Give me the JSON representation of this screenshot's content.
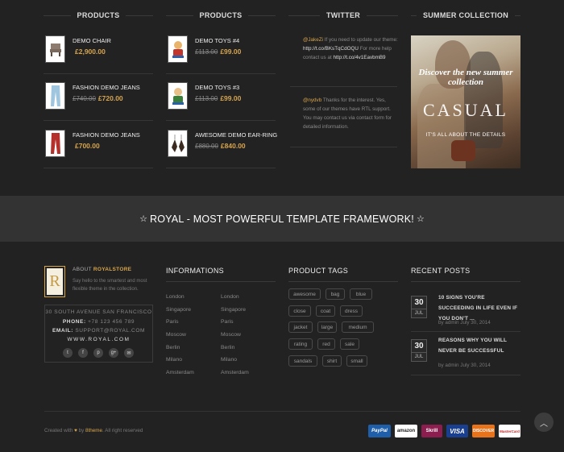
{
  "columns": {
    "products1_title": "PRODUCTS",
    "products2_title": "PRODUCTS",
    "twitter_title": "TWITTER",
    "summer_title": "SUMMER COLLECTION"
  },
  "products_left": [
    {
      "name": "DEMO CHAIR",
      "old_price": "",
      "price": "£2,900.00",
      "icon": "chair-thumbnail"
    },
    {
      "name": "FASHION DEMO JEANS",
      "old_price": "£740.00",
      "price": "£720.00",
      "icon": "jeans-thumbnail"
    },
    {
      "name": "FASHION DEMO JEANS",
      "old_price": "",
      "price": "£700.00",
      "icon": "red-jeans-thumbnail"
    }
  ],
  "products_right": [
    {
      "name": "DEMO TOYS #4",
      "old_price": "£113.00",
      "price": "£99.00",
      "icon": "toy-thumbnail"
    },
    {
      "name": "DEMO TOYS #3",
      "old_price": "£113.00",
      "price": "£99.00",
      "icon": "toy-thumbnail"
    },
    {
      "name": "AWESOME DEMO EAR-RING",
      "old_price": "£880.00",
      "price": "£840.00",
      "icon": "earring-thumbnail"
    }
  ],
  "tweets": [
    {
      "handle": "@JakeZi",
      "text": " If you need to update our theme: ",
      "link": "http://t.co/BKsTqCdOQU",
      "text2": " For more help contact us at ",
      "link2": "http://t.co/4v1EavbmB9"
    },
    {
      "handle": "@nydvb",
      "text": " Thanks for the interest. Yes, some of our themes have RTL support. You may contact us via contact form for detailed information.",
      "link": "",
      "text2": "",
      "link2": ""
    }
  ],
  "promo": {
    "line1": "Discover the new summer collection",
    "line2": "CASUAL",
    "line3": "IT'S ALL ABOUT THE DETAILS"
  },
  "banner": {
    "text": "ROYAL - MOST POWERFUL TEMPLATE FRAMEWORK!",
    "star": "☆"
  },
  "about": {
    "logo_letter": "R",
    "title_prefix": "ABOUT ",
    "title_brand": "ROYALSTORE",
    "description": "Say hello to the smartest and most flexible theme in the collection.",
    "address": "30 SOUTH AVENUE SAN FRANCISCO",
    "phone_label": "PHONE:",
    "phone": " +78 123 456 789",
    "email_label": "EMAIL:",
    "email": " SUPPORT@ROYAL.COM",
    "website": "WWW.ROYAL.COM",
    "social": [
      "t",
      "f",
      "p",
      "g+",
      "✉"
    ]
  },
  "informations": {
    "title": "INFORMATIONS",
    "col1": [
      "London",
      "Singapore",
      "Paris",
      "Moscow",
      "Berlin",
      "Milano",
      "Amsterdam"
    ],
    "col2": [
      "London",
      "Singapore",
      "Paris",
      "Moscow",
      "Berlin",
      "Milano",
      "Amsterdam"
    ]
  },
  "tags": {
    "title": "PRODUCT TAGS",
    "items": [
      "awesome",
      "bag",
      "blue",
      "close",
      "coat",
      "dress",
      "jacket",
      "large",
      "medium",
      "rating",
      "red",
      "sale",
      "sandals",
      "shirt",
      "small"
    ]
  },
  "recent_posts": {
    "title": "RECENT POSTS",
    "posts": [
      {
        "day": "30",
        "month": "JUL",
        "title": "10 SIGNS YOU'RE SUCCEEDING IN LIFE EVEN IF YOU DON'T ...",
        "meta": "by admin July 30, 2014"
      },
      {
        "day": "30",
        "month": "JUL",
        "title": "REASONS WHY YOU WILL NEVER BE SUCCESSFUL",
        "meta": "by admin July 30, 2014"
      }
    ]
  },
  "footer": {
    "created_with": "Created with ",
    "heart": "♥",
    "by": " by ",
    "brand": "8theme",
    "rights": ". All right reserved",
    "payments": [
      "PayPal",
      "amazon",
      "Skrill",
      "VISA",
      "DISCOVER",
      "MasterCard"
    ],
    "to_top": "︿"
  },
  "colors": {
    "accent": "#d7a54e",
    "background": "#222222",
    "banner": "#333333"
  }
}
